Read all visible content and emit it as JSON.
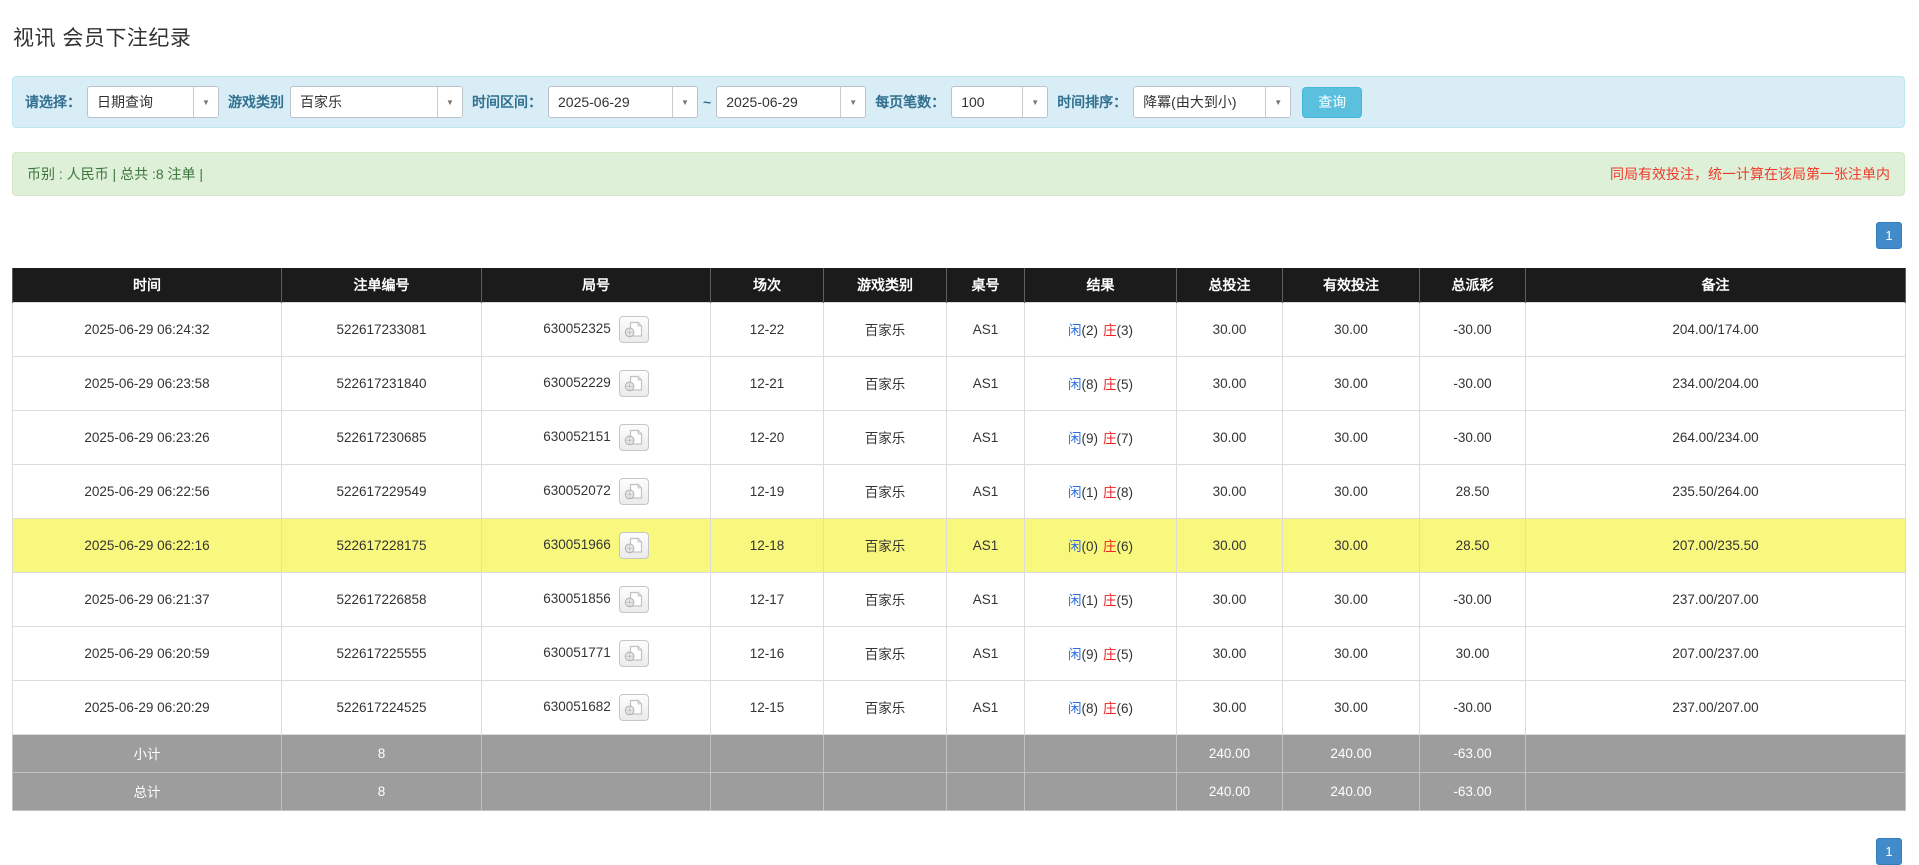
{
  "page": {
    "title": "视讯 会员下注纪录"
  },
  "filter_bar": {
    "select_label": "请选择：",
    "select_value": "日期查询",
    "game_type_label": "游戏类别",
    "game_type_value": "百家乐",
    "time_range_label": "时间区间：",
    "date_from": "2025-06-29",
    "range_separator": "~",
    "date_to": "2025-06-29",
    "page_size_label": "每页笔数：",
    "page_size_value": "100",
    "sort_label": "时间排序：",
    "sort_value": "降冪(由大到小)",
    "search_button_label": "查询",
    "dropdown_arrow": "▼"
  },
  "summary_bar": {
    "currency_info": "币别 : 人民币 | 总共 :8 注单 |",
    "notice": "同局有效投注，统一计算在该局第一张注单内"
  },
  "pagination": {
    "current_page": "1"
  },
  "table": {
    "headers": [
      "时间",
      "注单编号",
      "局号",
      "场次",
      "游戏类别",
      "桌号",
      "结果",
      "总投注",
      "有效投注",
      "总派彩",
      "备注"
    ],
    "rows": [
      {
        "time": "2025-06-29 06:24:32",
        "bet_id": "522617233081",
        "round_id": "630052325",
        "session": "12-22",
        "game_type": "百家乐",
        "table_no": "AS1",
        "result": {
          "player": "闲",
          "player_score": "(2)",
          "banker": "庄",
          "banker_score": "(3)"
        },
        "total_bet": "30.00",
        "valid_bet": "30.00",
        "total_payout": "-30.00",
        "remark": "204.00/174.00",
        "highlighted": false
      },
      {
        "time": "2025-06-29 06:23:58",
        "bet_id": "522617231840",
        "round_id": "630052229",
        "session": "12-21",
        "game_type": "百家乐",
        "table_no": "AS1",
        "result": {
          "player": "闲",
          "player_score": "(8)",
          "banker": "庄",
          "banker_score": "(5)"
        },
        "total_bet": "30.00",
        "valid_bet": "30.00",
        "total_payout": "-30.00",
        "remark": "234.00/204.00",
        "highlighted": false
      },
      {
        "time": "2025-06-29 06:23:26",
        "bet_id": "522617230685",
        "round_id": "630052151",
        "session": "12-20",
        "game_type": "百家乐",
        "table_no": "AS1",
        "result": {
          "player": "闲",
          "player_score": "(9)",
          "banker": "庄",
          "banker_score": "(7)"
        },
        "total_bet": "30.00",
        "valid_bet": "30.00",
        "total_payout": "-30.00",
        "remark": "264.00/234.00",
        "highlighted": false
      },
      {
        "time": "2025-06-29 06:22:56",
        "bet_id": "522617229549",
        "round_id": "630052072",
        "session": "12-19",
        "game_type": "百家乐",
        "table_no": "AS1",
        "result": {
          "player": "闲",
          "player_score": "(1)",
          "banker": "庄",
          "banker_score": "(8)"
        },
        "total_bet": "30.00",
        "valid_bet": "30.00",
        "total_payout": "28.50",
        "remark": "235.50/264.00",
        "highlighted": false
      },
      {
        "time": "2025-06-29 06:22:16",
        "bet_id": "522617228175",
        "round_id": "630051966",
        "session": "12-18",
        "game_type": "百家乐",
        "table_no": "AS1",
        "result": {
          "player": "闲",
          "player_score": "(0)",
          "banker": "庄",
          "banker_score": "(6)"
        },
        "total_bet": "30.00",
        "valid_bet": "30.00",
        "total_payout": "28.50",
        "remark": "207.00/235.50",
        "highlighted": true
      },
      {
        "time": "2025-06-29 06:21:37",
        "bet_id": "522617226858",
        "round_id": "630051856",
        "session": "12-17",
        "game_type": "百家乐",
        "table_no": "AS1",
        "result": {
          "player": "闲",
          "player_score": "(1)",
          "banker": "庄",
          "banker_score": "(5)"
        },
        "total_bet": "30.00",
        "valid_bet": "30.00",
        "total_payout": "-30.00",
        "remark": "237.00/207.00",
        "highlighted": false
      },
      {
        "time": "2025-06-29 06:20:59",
        "bet_id": "522617225555",
        "round_id": "630051771",
        "session": "12-16",
        "game_type": "百家乐",
        "table_no": "AS1",
        "result": {
          "player": "闲",
          "player_score": "(9)",
          "banker": "庄",
          "banker_score": "(5)"
        },
        "total_bet": "30.00",
        "valid_bet": "30.00",
        "total_payout": "30.00",
        "remark": "207.00/237.00",
        "highlighted": false
      },
      {
        "time": "2025-06-29 06:20:29",
        "bet_id": "522617224525",
        "round_id": "630051682",
        "session": "12-15",
        "game_type": "百家乐",
        "table_no": "AS1",
        "result": {
          "player": "闲",
          "player_score": "(8)",
          "banker": "庄",
          "banker_score": "(6)"
        },
        "total_bet": "30.00",
        "valid_bet": "30.00",
        "total_payout": "-30.00",
        "remark": "237.00/207.00",
        "highlighted": false
      }
    ],
    "subtotal": {
      "label": "小计",
      "count": "8",
      "total_bet": "240.00",
      "valid_bet": "240.00",
      "total_payout": "-63.00"
    },
    "total": {
      "label": "总计",
      "count": "8",
      "total_bet": "240.00",
      "valid_bet": "240.00",
      "total_payout": "-63.00"
    }
  },
  "colors": {
    "header_bg": "#1b1b1b",
    "highlight_row": "#f8f87f",
    "link_blue": "#2a6ee0",
    "negative_red": "#ee2222",
    "summary_row_bg": "#9d9d9d",
    "filter_panel_bg": "#d9edf7",
    "info_bar_bg": "#dff0d8",
    "info_bar_text": "#3c763d",
    "notice_red": "#f0392b",
    "search_button_bg": "#5bc0de",
    "pager_button_bg": "#428bca"
  }
}
